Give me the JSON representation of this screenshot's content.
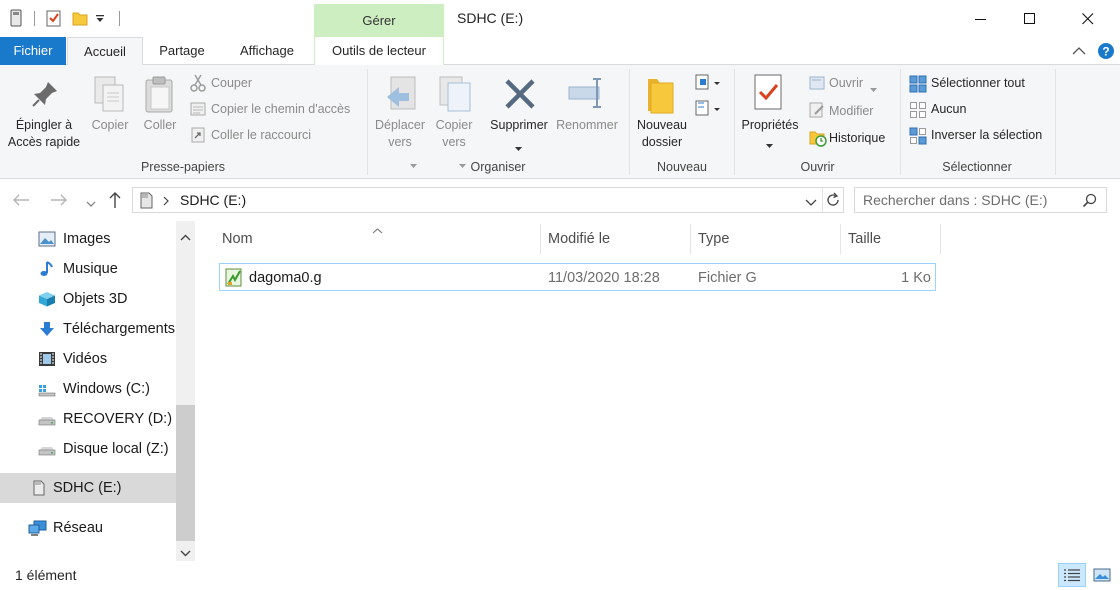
{
  "window": {
    "title": "SDHC (E:)",
    "context_tab_group": "Gérer"
  },
  "tabs": {
    "file": "Fichier",
    "home": "Accueil",
    "share": "Partage",
    "view": "Affichage",
    "drive_tools": "Outils de lecteur"
  },
  "ribbon": {
    "clipboard": {
      "label": "Presse-papiers",
      "pin_line1": "Épingler à",
      "pin_line2": "Accès rapide",
      "copy": "Copier",
      "paste": "Coller",
      "cut": "Couper",
      "copy_path": "Copier le chemin d'accès",
      "paste_shortcut": "Coller le raccourci"
    },
    "organize": {
      "label": "Organiser",
      "move_line1": "Déplacer",
      "move_line2": "vers",
      "copyto_line1": "Copier",
      "copyto_line2": "vers",
      "delete": "Supprimer",
      "rename": "Renommer"
    },
    "new": {
      "label": "Nouveau",
      "new_folder_line1": "Nouveau",
      "new_folder_line2": "dossier"
    },
    "open": {
      "label": "Ouvrir",
      "properties": "Propriétés",
      "open": "Ouvrir",
      "edit": "Modifier",
      "history": "Historique"
    },
    "select": {
      "label": "Sélectionner",
      "select_all": "Sélectionner tout",
      "select_none": "Aucun",
      "invert": "Inverser la sélection"
    }
  },
  "address": {
    "path": "SDHC (E:)",
    "search_placeholder": "Rechercher dans : SDHC (E:)"
  },
  "nav": {
    "items": [
      {
        "label": "Images",
        "icon": "pictures-icon"
      },
      {
        "label": "Musique",
        "icon": "music-icon"
      },
      {
        "label": "Objets 3D",
        "icon": "objects-3d-icon"
      },
      {
        "label": "Téléchargements",
        "icon": "downloads-icon"
      },
      {
        "label": "Vidéos",
        "icon": "videos-icon"
      },
      {
        "label": "Windows (C:)",
        "icon": "windows-drive-icon"
      },
      {
        "label": "RECOVERY (D:)",
        "icon": "drive-icon"
      },
      {
        "label": "Disque local (Z:)",
        "icon": "drive-icon"
      },
      {
        "label": "SDHC (E:)",
        "icon": "sd-card-icon"
      },
      {
        "label": "Réseau",
        "icon": "network-icon"
      }
    ]
  },
  "columns": {
    "name": "Nom",
    "modified": "Modifié le",
    "type": "Type",
    "size": "Taille"
  },
  "files": [
    {
      "name": "dagoma0.g",
      "modified": "11/03/2020 18:28",
      "type": "Fichier G",
      "size": "1 Ko"
    }
  ],
  "status": {
    "count": "1 élément"
  },
  "colors": {
    "accent": "#1979ca",
    "context_tab": "#cdeec0",
    "selection": "#d9d9d9",
    "row_border": "#99d1ff"
  }
}
